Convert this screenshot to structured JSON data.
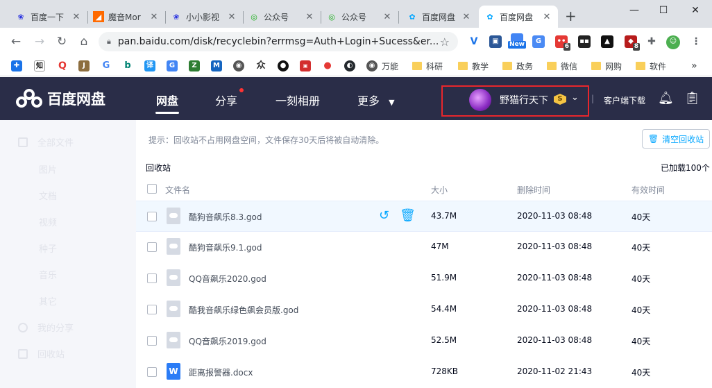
{
  "browser": {
    "tabs": [
      {
        "title": "百度一下",
        "icon": "baidu-paw-icon",
        "active": false
      },
      {
        "title": "魔音Mor",
        "icon": "moyin-icon",
        "active": false
      },
      {
        "title": "小小影视",
        "icon": "baidu-paw-icon",
        "active": false
      },
      {
        "title": "公众号",
        "icon": "green-swirl-icon",
        "active": false
      },
      {
        "title": "公众号",
        "icon": "green-swirl-icon",
        "active": false
      },
      {
        "title": "百度网盘",
        "icon": "baidu-netdisk-icon",
        "active": false
      },
      {
        "title": "百度网盘",
        "icon": "baidu-netdisk-icon",
        "active": true
      }
    ],
    "new_tab": "+",
    "window_controls": {
      "minimize": "—",
      "maximize": "☐",
      "close": "✕"
    },
    "url": "pan.baidu.com/disk/recyclebin?errmsg=Auth+Login+Sucess&er...",
    "extension_badges": {
      "ext6": "6",
      "ext8": "8",
      "new": "New"
    },
    "bookmarks": [
      {
        "label": "",
        "icon": "puzzle-icon"
      },
      {
        "label": "",
        "icon": "zhi-icon"
      },
      {
        "label": "",
        "icon": "q-icon"
      },
      {
        "label": "",
        "icon": "j-icon"
      },
      {
        "label": "",
        "icon": "google-icon"
      },
      {
        "label": "",
        "icon": "bing-icon"
      },
      {
        "label": "",
        "icon": "translate-icon"
      },
      {
        "label": "",
        "icon": "google-translate-icon"
      },
      {
        "label": "",
        "icon": "z-icon"
      },
      {
        "label": "",
        "icon": "bookmark-icon"
      },
      {
        "label": "",
        "icon": "globe-icon"
      },
      {
        "label": "",
        "icon": "zhong-icon"
      },
      {
        "label": "",
        "icon": "circle-icon"
      },
      {
        "label": "",
        "icon": "red-badge-icon"
      },
      {
        "label": "",
        "icon": "berry-icon"
      },
      {
        "label": "",
        "icon": "github-icon"
      },
      {
        "label": "万能",
        "icon": "globe-icon"
      },
      {
        "label": "科研",
        "icon": "folder-icon"
      },
      {
        "label": "教学",
        "icon": "folder-icon"
      },
      {
        "label": "政务",
        "icon": "folder-icon"
      },
      {
        "label": "微信",
        "icon": "folder-icon"
      },
      {
        "label": "网购",
        "icon": "folder-icon"
      },
      {
        "label": "软件",
        "icon": "folder-icon"
      }
    ],
    "bookmarks_more": "»"
  },
  "header": {
    "logo": "百度网盘",
    "nav": [
      {
        "label": "网盘",
        "active": true
      },
      {
        "label": "分享",
        "active": false
      },
      {
        "label": "一刻相册",
        "active": false
      },
      {
        "label": "更多",
        "active": false
      }
    ],
    "user": {
      "name": "野猫行天下",
      "vip": "S"
    },
    "client_download": "客户端下载"
  },
  "sidebar": {
    "items": [
      {
        "label": "全部文件",
        "icon": "file-icon"
      },
      {
        "label": "图片"
      },
      {
        "label": "文档"
      },
      {
        "label": "视频"
      },
      {
        "label": "种子"
      },
      {
        "label": "音乐"
      },
      {
        "label": "其它"
      },
      {
        "label": "我的分享",
        "icon": "share-icon"
      },
      {
        "label": "回收站",
        "icon": "trash-icon"
      }
    ]
  },
  "main": {
    "tip": "提示：回收站不占用网盘空间，文件保存30天后将被自动清除。",
    "clear_button": "清空回收站",
    "breadcrumb": "回收站",
    "loaded_count": "已加载100个",
    "columns": {
      "name": "文件名",
      "size": "大小",
      "deleted": "删除时间",
      "valid": "有效时间"
    },
    "files": [
      {
        "name": "酷狗音飙乐8.3.god",
        "size": "43.7M",
        "deleted": "2020-11-03 08:48",
        "valid": "40天",
        "type": "cloud"
      },
      {
        "name": "酷狗音飙乐9.1.god",
        "size": "47M",
        "deleted": "2020-11-03 08:48",
        "valid": "40天",
        "type": "cloud"
      },
      {
        "name": "QQ音飙乐2020.god",
        "size": "51.9M",
        "deleted": "2020-11-03 08:48",
        "valid": "40天",
        "type": "cloud"
      },
      {
        "name": "酷我音飙乐绿色飙会员版.god",
        "size": "54.4M",
        "deleted": "2020-11-03 08:48",
        "valid": "40天",
        "type": "cloud"
      },
      {
        "name": "QQ音飙乐2019.god",
        "size": "52.5M",
        "deleted": "2020-11-03 08:48",
        "valid": "40天",
        "type": "cloud"
      },
      {
        "name": "距离报警器.docx",
        "size": "728KB",
        "deleted": "2020-11-02 21:43",
        "valid": "40天",
        "type": "word"
      }
    ]
  },
  "colors": {
    "header_bg": "#2a2d48",
    "accent": "#06a7ff",
    "highlight_box": "#e8262c"
  }
}
